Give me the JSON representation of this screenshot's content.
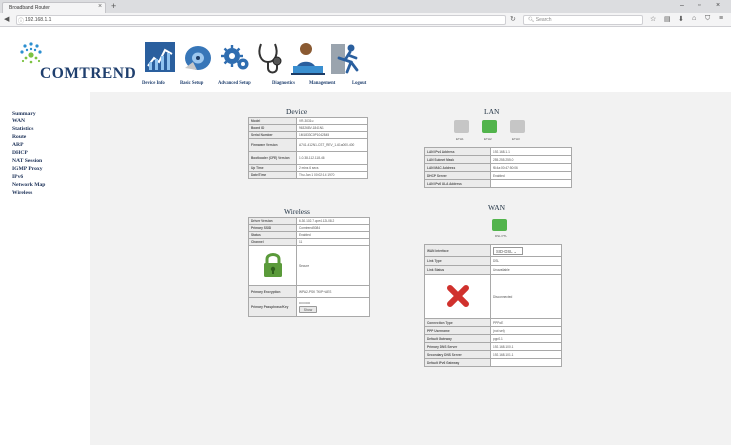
{
  "browser": {
    "tab_title": "Broadband Router",
    "url": "192.168.1.1",
    "search_placeholder": "Search"
  },
  "brand": {
    "logo_text": "COMTREND"
  },
  "top_nav": [
    {
      "label": "Device Info",
      "icon": "chart-icon"
    },
    {
      "label": "Basic Setup",
      "icon": "disk-icon"
    },
    {
      "label": "Advanced Setup",
      "icon": "gears-icon"
    },
    {
      "label": "Diagnostics",
      "icon": "stethoscope-icon"
    },
    {
      "label": "Management",
      "icon": "user-laptop-icon"
    },
    {
      "label": "Logout",
      "icon": "running-man-icon"
    }
  ],
  "sidebar": [
    "Summary",
    "WAN",
    "Statistics",
    "Route",
    "ARP",
    "DHCP",
    "NAT Session",
    "IGMP Proxy",
    "IPv6",
    "Network Map",
    "Wireless"
  ],
  "device": {
    "title": "Device",
    "rows": [
      {
        "k": "Model",
        "v": "VR-3031u"
      },
      {
        "k": "Board ID",
        "v": "963268V-1841N1"
      },
      {
        "k": "Serial Number",
        "v": "1M1833C0P1042845"
      },
      {
        "k": "Firmware Version",
        "v": "A741-412N1-CST_REV_1-61a000-400"
      },
      {
        "k": "Bootloader (CFE) Version",
        "v": "1.0.38-112.118-46"
      },
      {
        "k": "Up Time",
        "v": "2 mins 6 secs"
      },
      {
        "k": "Date/Time",
        "v": "Thu Jan 1 00:02:14 1970"
      }
    ]
  },
  "lan": {
    "title": "LAN",
    "ports": [
      {
        "label": "ETH1",
        "active": false
      },
      {
        "label": "ETH2",
        "active": true
      },
      {
        "label": "ETH3",
        "active": false
      }
    ],
    "rows": [
      {
        "k": "LAN IPv4 Address",
        "v": "192.168.1.1"
      },
      {
        "k": "LAN Subnet Mask",
        "v": "255.255.255.0"
      },
      {
        "k": "LAN MAC Address",
        "v": "f8:4a:00:47:50:06"
      },
      {
        "k": "DHCP Server",
        "v": "Enabled"
      },
      {
        "k": "LAN IPv6 ULA Address",
        "v": ""
      }
    ]
  },
  "wireless": {
    "title": "Wireless",
    "rows": [
      {
        "k": "Driver Version",
        "v": "6.30.102.7.cpe4.12L08.2"
      },
      {
        "k": "Primary SSID",
        "v": "Comtrend5084"
      },
      {
        "k": "Status",
        "v": "Enabled"
      },
      {
        "k": "Channel",
        "v": "11"
      }
    ],
    "security_text": "Secure",
    "encryption_key": "Primary Encryption",
    "encryption_val": "WPA2-PSK TKIP+AES",
    "pass_key": "Primary Passphrase/Key",
    "pass_val": "••••••••••",
    "show_label": "Show"
  },
  "wan": {
    "title": "WAN",
    "port_label": "DSL PTL",
    "interface_key": "WAN Interface",
    "interface_value": "SID-DSL",
    "rows_top": [
      {
        "k": "Link Type",
        "v": "DSL"
      },
      {
        "k": "Link Status",
        "v": "Unavailable"
      }
    ],
    "status_text": "Disconnected",
    "rows_bottom": [
      {
        "k": "Connection Type",
        "v": "PPPoE"
      },
      {
        "k": "PPP Username",
        "v": "(not set)"
      },
      {
        "k": "Default Gateway",
        "v": "ppp0.1"
      },
      {
        "k": "Primary DNS Server",
        "v": "192.168.100.1"
      },
      {
        "k": "Secondary DNS Server",
        "v": "192.168.101.1"
      },
      {
        "k": "Default IPv6 Gateway",
        "v": ""
      }
    ]
  },
  "colors": {
    "brand": "#1f3f6e",
    "port_active": "#52b44c",
    "port_inactive": "#c6c6c6",
    "lock": "#5a9a3a",
    "x_mark": "#d0312d"
  }
}
